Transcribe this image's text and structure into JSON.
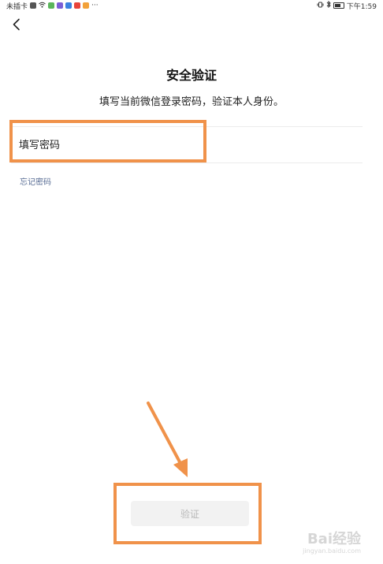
{
  "status_bar": {
    "carrier": "未插卡",
    "time": "下午1:59",
    "more": "···"
  },
  "header": {
    "back_icon": "chevron-left-icon"
  },
  "main": {
    "title": "安全验证",
    "subtitle": "填写当前微信登录密码，验证本人身份。",
    "password_placeholder": "填写密码",
    "forgot_password": "忘记密码",
    "verify_button": "验证"
  },
  "annotations": {
    "highlight_color": "#f0924a"
  },
  "watermark": {
    "brand": "Bai经验",
    "url": "jingyan.baidu.com"
  },
  "colors": {
    "link": "#586c94",
    "button_bg": "#f2f2f2",
    "button_text": "#b8b8b8"
  }
}
